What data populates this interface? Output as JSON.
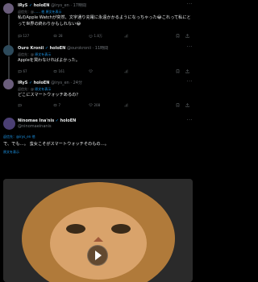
{
  "tweets": [
    {
      "name": "IRyS",
      "suffix": "holoEN",
      "handle": "@irys_en · 17時間",
      "reply_to_label": "返信先：@",
      "reply_to": "…… 他",
      "translated": "原文を表示",
      "text": "私のApple Watchが突然、文字通り充電に永遠かかるようになっちゃった😂これって私にとって世界の終わりかもしれない😂",
      "stats": {
        "reply": "127",
        "retweet": "28",
        "like": "1.8万",
        "views": ""
      }
    },
    {
      "name": "Ouro Kronii",
      "suffix": "holoEN",
      "handle": "@ourokronii · 11時間",
      "reply_to_label": "返信先：@",
      "reply_to": "",
      "translated": "原文を表示",
      "text": "Appleを買わなければよかった。",
      "stats": {
        "reply": "67",
        "retweet": "161",
        "like": "",
        "views": ""
      }
    },
    {
      "name": "IRyS",
      "suffix": "holoEN",
      "handle": "@irys_en · 24分",
      "reply_to_label": "返信先：@",
      "reply_to": "",
      "translated": "原文を表示",
      "text": "どこにスマートウォッチあるの？",
      "stats": {
        "reply": "",
        "retweet": "7",
        "like": "208",
        "views": ""
      }
    },
    {
      "name": "Ninomae Ina'nis",
      "suffix": "holoEN",
      "handle": "@ninomaeinanis",
      "reply_to_label": "",
      "reply_to": "",
      "translated": "",
      "text": "",
      "stats": {}
    }
  ],
  "main_tweet": {
    "reply_to_label": "返信先：@irys_en 他",
    "translated_note": "原文を表示",
    "text": "で、でも…。 蛮女こそがスマートウォッチそのもの…。"
  },
  "media": {
    "play_label": ""
  },
  "colors": {
    "background": "#000000",
    "text": "#e7e9ea",
    "muted": "#71767b",
    "link": "#1d9bf0",
    "divider": "#2f3336"
  },
  "icons": [
    "reply-icon",
    "retweet-icon",
    "like-icon",
    "views-icon",
    "bookmark-icon",
    "share-icon",
    "more-icon",
    "verified-icon",
    "play-icon"
  ]
}
